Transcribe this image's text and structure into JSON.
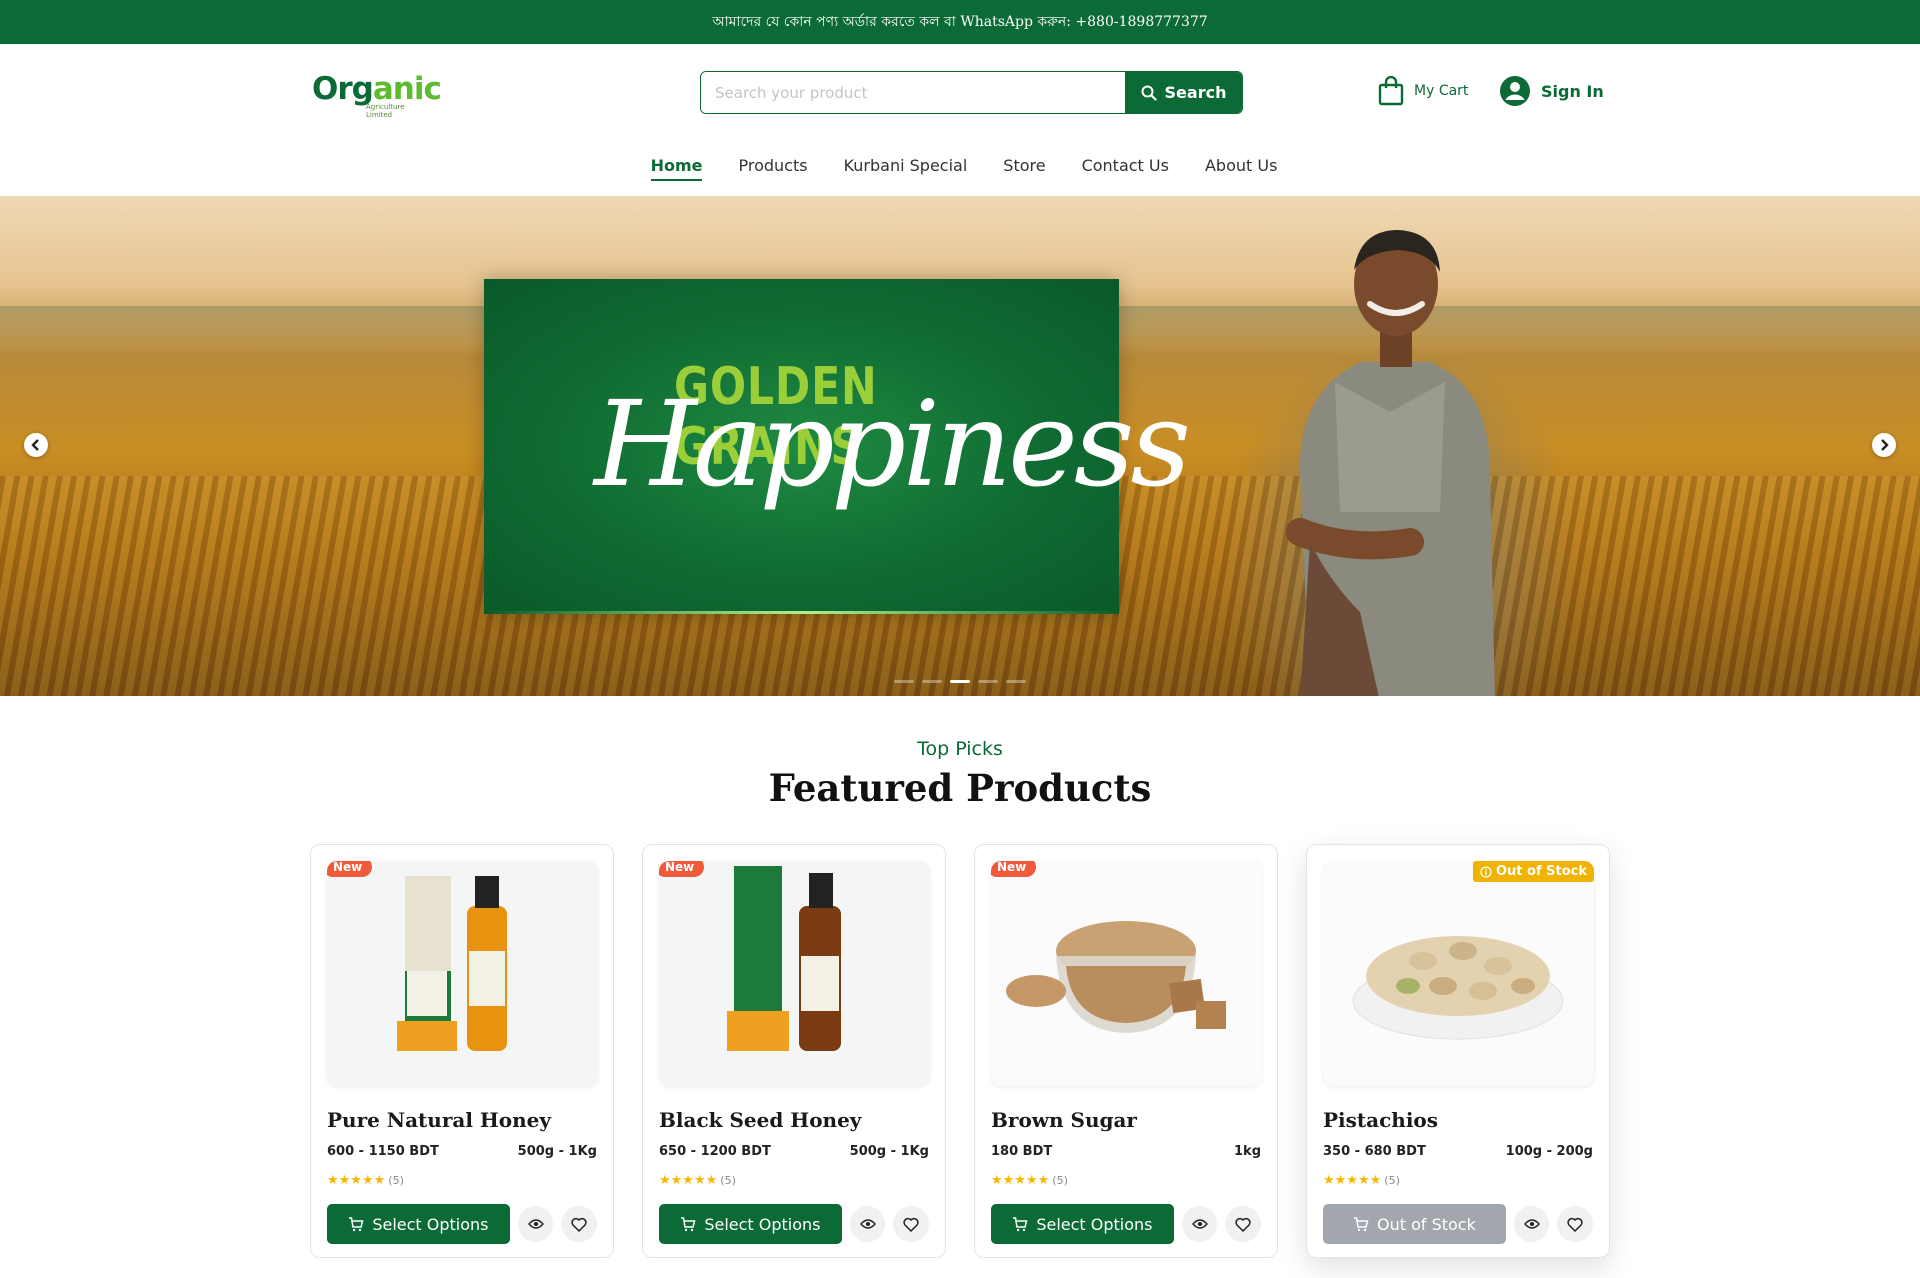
{
  "topbar": {
    "text": "আমাদের যে কোন পণ্য অর্ডার করতে কল বা WhatsApp করুন: +880-1898777377"
  },
  "logo": {
    "word_a": "Org",
    "word_b": "anic",
    "sub": "Agriculture Limited"
  },
  "search": {
    "placeholder": "Search your product",
    "button": "Search"
  },
  "header": {
    "cart": "My Cart",
    "signin": "Sign In"
  },
  "nav": [
    {
      "label": "Home",
      "active": true
    },
    {
      "label": "Products"
    },
    {
      "label": "Kurbani Special"
    },
    {
      "label": "Store"
    },
    {
      "label": "Contact Us"
    },
    {
      "label": "About Us"
    }
  ],
  "hero": {
    "line1": "GOLDEN GRAINS",
    "line2": "Happiness",
    "active_slide": 3
  },
  "section": {
    "kicker": "Top Picks",
    "title": "Featured Products"
  },
  "products": [
    {
      "name": "Pure Natural Honey",
      "price": "600 - 1150 BDT",
      "weight": "500g - 1Kg",
      "rating_count": "(5)",
      "badge": "New",
      "action": "Select Options"
    },
    {
      "name": "Black Seed Honey",
      "price": "650 - 1200 BDT",
      "weight": "500g - 1Kg",
      "rating_count": "(5)",
      "badge": "New",
      "action": "Select Options"
    },
    {
      "name": "Brown Sugar",
      "price": "180 BDT",
      "weight": "1kg",
      "rating_count": "(5)",
      "badge": "New",
      "action": "Select Options"
    },
    {
      "name": "Pistachios",
      "price": "350 - 680 BDT",
      "weight": "100g - 200g",
      "rating_count": "(5)",
      "badge": "Out of Stock",
      "action": "Out of Stock"
    }
  ],
  "colors": {
    "brand": "#0b6a36",
    "badge_new": "#ee5a3a",
    "badge_oos": "#f0b400",
    "star": "#f5b800"
  }
}
